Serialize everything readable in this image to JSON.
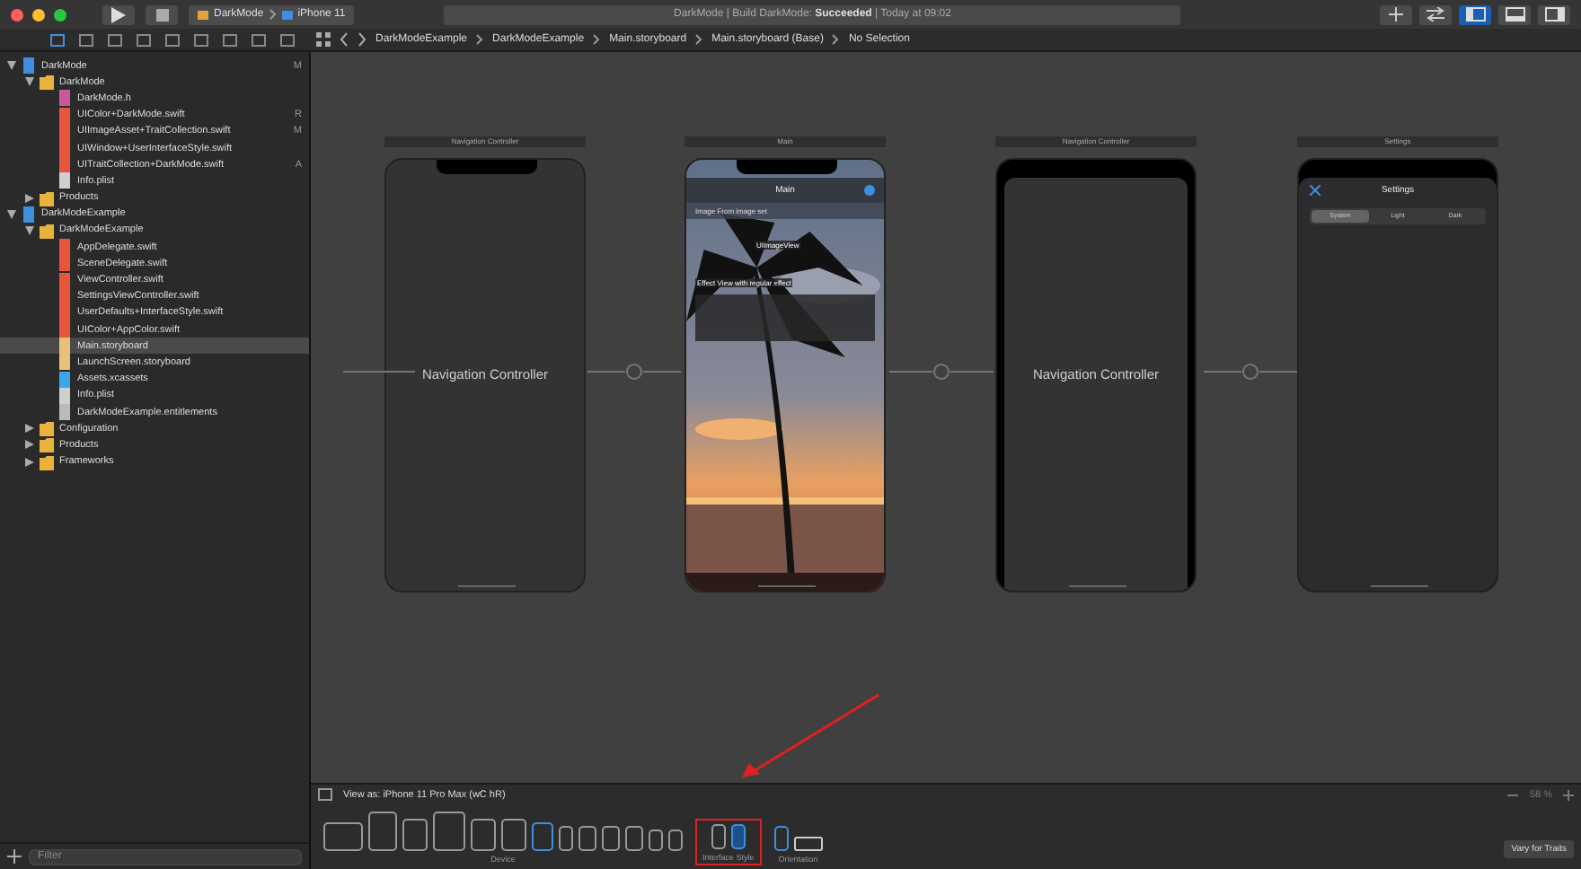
{
  "toolbar": {
    "scheme": "DarkMode",
    "device": "iPhone 11",
    "activity": "DarkMode | Build DarkMode: **Succeeded** | Today at 09:02",
    "panels": [
      {
        "kind": "navigator",
        "selected": true
      },
      {
        "kind": "debug",
        "selected": false
      },
      {
        "kind": "inspector",
        "selected": false
      }
    ]
  },
  "jump_bar": [
    "DarkModeExample",
    "DarkModeExample",
    "Main.storyboard",
    "Main.storyboard (Base)",
    "No Selection"
  ],
  "navigator": {
    "items": [
      {
        "name": "DarkMode",
        "kind": "project",
        "badge": "M",
        "expanded": true,
        "selected": false,
        "children": [
          {
            "name": "DarkMode",
            "kind": "folder",
            "expanded": true,
            "selected": false,
            "children": [
              {
                "name": "DarkMode.h",
                "kind": "header",
                "selected": false
              },
              {
                "name": "UIColor+DarkMode.swift",
                "kind": "swift",
                "badge": "R",
                "selected": false
              },
              {
                "name": "UIImageAsset+TraitCollection.swift",
                "kind": "swift",
                "badge": "M",
                "selected": false
              },
              {
                "name": "UIWindow+UserInterfaceStyle.swift",
                "kind": "swift",
                "selected": false
              },
              {
                "name": "UITraitCollection+DarkMode.swift",
                "kind": "swift",
                "badge": "A",
                "selected": false
              },
              {
                "name": "Info.plist",
                "kind": "file",
                "selected": false
              }
            ]
          },
          {
            "name": "Products",
            "kind": "folder",
            "expanded": false,
            "selected": false
          }
        ]
      },
      {
        "name": "DarkModeExample",
        "kind": "project",
        "expanded": true,
        "selected": false,
        "children": [
          {
            "name": "DarkModeExample",
            "kind": "folder",
            "expanded": true,
            "selected": false,
            "children": [
              {
                "name": "AppDelegate.swift",
                "kind": "swift",
                "selected": false
              },
              {
                "name": "SceneDelegate.swift",
                "kind": "swift",
                "selected": false
              },
              {
                "name": "ViewController.swift",
                "kind": "swift",
                "selected": false
              },
              {
                "name": "SettingsViewController.swift",
                "kind": "swift",
                "selected": false
              },
              {
                "name": "UserDefaults+InterfaceStyle.swift",
                "kind": "swift",
                "selected": false
              },
              {
                "name": "UIColor+AppColor.swift",
                "kind": "swift",
                "selected": false
              },
              {
                "name": "Main.storyboard",
                "kind": "storyboard",
                "selected": true
              },
              {
                "name": "LaunchScreen.storyboard",
                "kind": "storyboard",
                "selected": false
              },
              {
                "name": "Assets.xcassets",
                "kind": "assets",
                "selected": false
              },
              {
                "name": "Info.plist",
                "kind": "file",
                "selected": false
              },
              {
                "name": "DarkModeExample.entitlements",
                "kind": "entitlements",
                "selected": false
              }
            ]
          },
          {
            "name": "Configuration",
            "kind": "folder",
            "expanded": false,
            "selected": false
          },
          {
            "name": "Products",
            "kind": "folder",
            "expanded": false,
            "selected": false
          },
          {
            "name": "Frameworks",
            "kind": "folder",
            "expanded": false,
            "selected": false
          }
        ]
      }
    ],
    "filter": {
      "placeholder": "Filter"
    }
  },
  "scenes": [
    {
      "kind": "navigation",
      "label": "Navigation Controller",
      "title": "Navigation Controller"
    },
    {
      "kind": "main",
      "label": "Main",
      "title": "Main",
      "image_label": "Image From image set",
      "image_view": "UIImageView",
      "effect_label": "Effect View with regular effect"
    },
    {
      "kind": "navigation_sheet",
      "label": "Navigation Controller",
      "title": "Navigation Controller"
    },
    {
      "kind": "settings",
      "label": "Settings",
      "title": "Settings",
      "segments": [
        {
          "label": "System",
          "selected": true
        },
        {
          "label": "Light",
          "selected": false
        },
        {
          "label": "Dark",
          "selected": false
        }
      ]
    }
  ],
  "bottom_bar": {
    "view_as": "View as: iPhone 11 Pro Max (wC hR)",
    "zoom": "58 %",
    "device_label": "Device",
    "style_label": "Interface Style",
    "orientation_label": "Orientation",
    "vary_button": "Vary for Traits"
  }
}
